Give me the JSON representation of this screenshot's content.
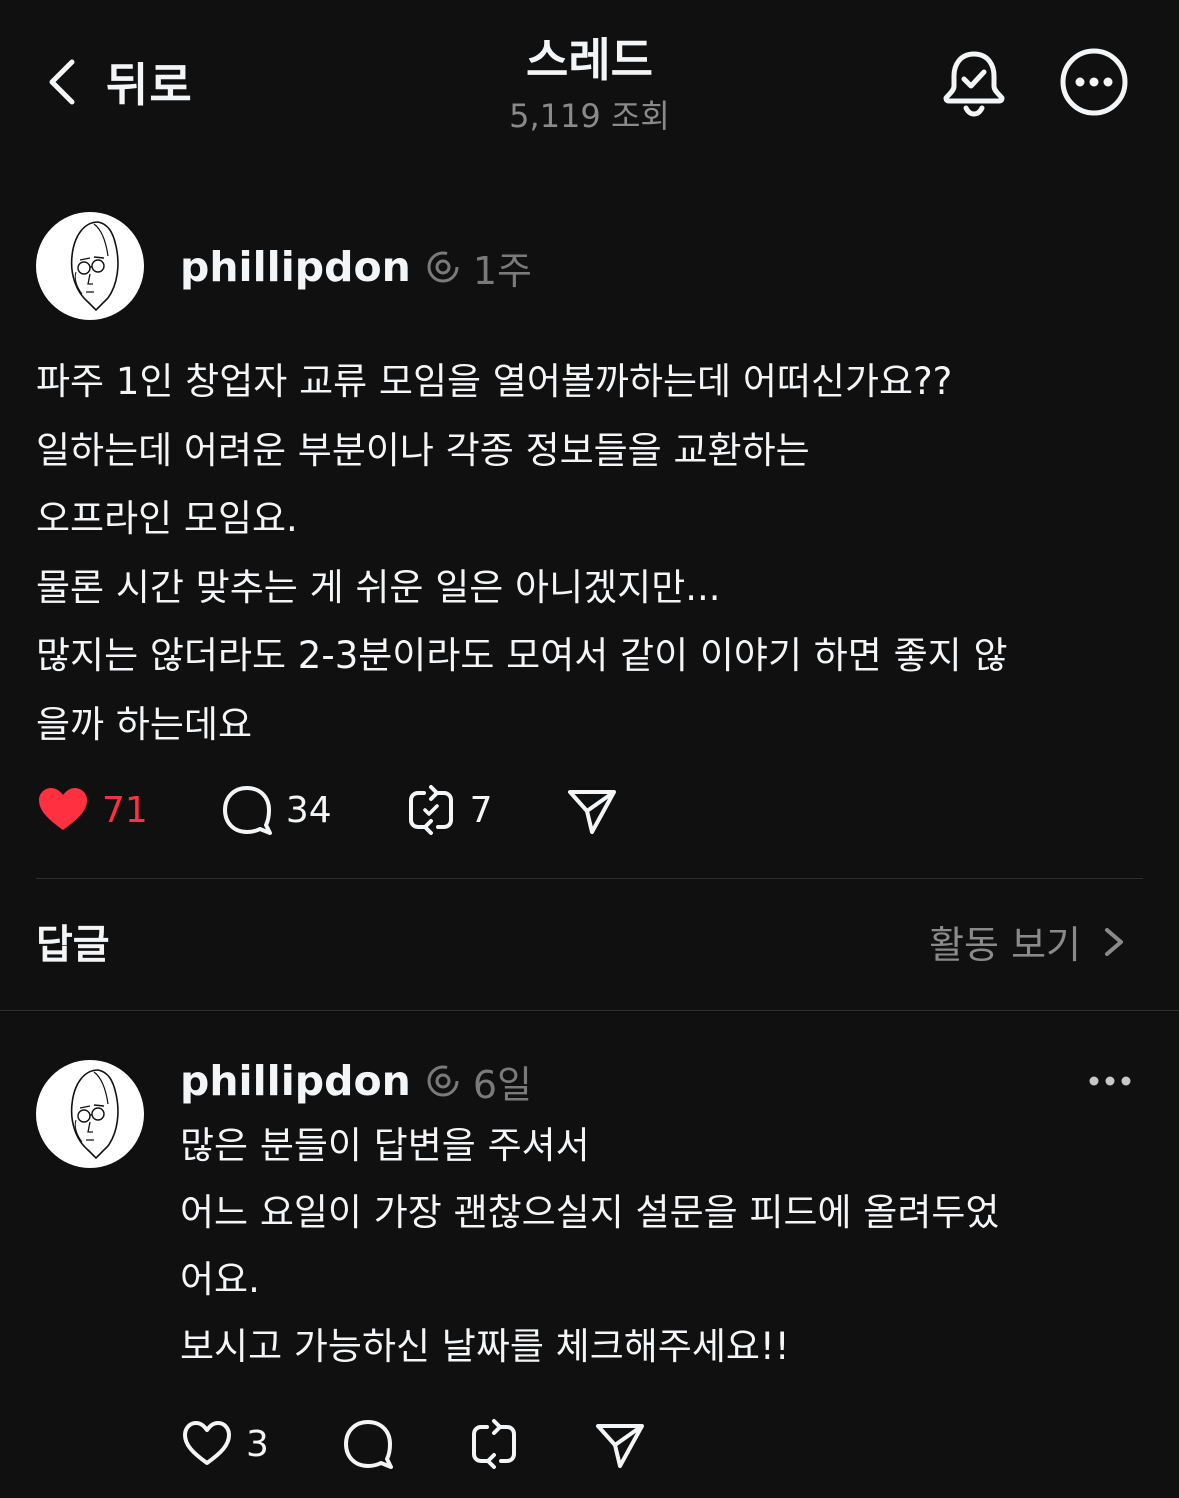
{
  "header": {
    "back_label": "뒤로",
    "title": "스레드",
    "views_count": "5,119",
    "views_label": "조회"
  },
  "post": {
    "username": "phillipdon",
    "time": "1주",
    "lines": [
      "파주 1인 창업자 교류 모임을 열어볼까하는데 어떠신가요??",
      "일하는데 어려운 부분이나 각종 정보들을 교환하는",
      "오프라인 모임요.",
      "물론 시간 맞추는 게 쉬운 일은 아니겠지만...",
      "많지는 않더라도 2-3분이라도 모여서 같이 이야기 하면 좋지 않",
      "을까 하는데요"
    ],
    "likes": "71",
    "comments": "34",
    "reposts": "7",
    "liked": true
  },
  "replies_section": {
    "title": "답글",
    "activity_label": "활동 보기"
  },
  "reply": {
    "username": "phillipdon",
    "time": "6일",
    "lines": [
      "많은 분들이 답변을 주셔서",
      "어느 요일이 가장 괜찮으실지 설문을 피드에 올려두었",
      "어요.",
      "보시고 가능하신 날짜를 체크해주세요!!"
    ],
    "likes": "3"
  },
  "colors": {
    "background": "#101010",
    "text": "#f3f5f7",
    "muted": "#8a8a8a",
    "like": "#ff3040",
    "divider": "#2f2f2f"
  }
}
